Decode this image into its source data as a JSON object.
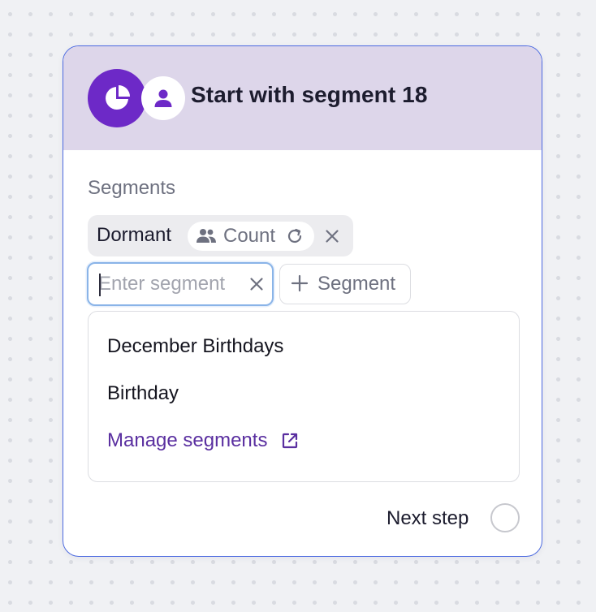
{
  "node": {
    "title": "Start with segment 18",
    "segment_icon": "pie-chart-icon",
    "person_icon": "person-icon"
  },
  "segments_section": {
    "label": "Segments",
    "chips": [
      {
        "label": "Dormant",
        "count_label": "Count",
        "count_icon": "people-icon",
        "refresh_icon": "refresh-icon",
        "remove_icon": "close-icon"
      }
    ],
    "input": {
      "value": "",
      "placeholder": "Enter segment",
      "clear_icon": "close-icon"
    },
    "add_button": {
      "label": "Segment",
      "icon": "plus-icon"
    },
    "dropdown": {
      "items": [
        "December Birthdays",
        "Birthday"
      ],
      "manage_label": "Manage segments",
      "manage_icon": "external-link-icon"
    }
  },
  "footer": {
    "next_step_label": "Next step"
  },
  "colors": {
    "accent_purple": "#6d29c7",
    "header_bg": "#ddd6ea",
    "card_border": "#4c6ae0",
    "link_purple": "#5a2fa0",
    "input_focus_border": "#8ab4e8"
  }
}
